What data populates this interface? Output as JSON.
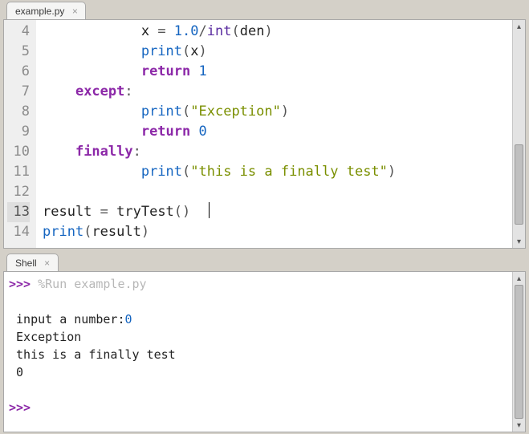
{
  "editor": {
    "tab_label": "example.py",
    "first_line_no": 4,
    "current_line_no": 13,
    "lines": [
      {
        "n": 4,
        "segs": [
          [
            "            ",
            "nm"
          ],
          [
            "x ",
            "nm"
          ],
          [
            "= ",
            "op"
          ],
          [
            "1.0",
            "num"
          ],
          [
            "/",
            "op"
          ],
          [
            "int",
            "bi"
          ],
          [
            "(",
            "op"
          ],
          [
            "den",
            "nm"
          ],
          [
            ")",
            "op"
          ]
        ]
      },
      {
        "n": 5,
        "segs": [
          [
            "            ",
            "nm"
          ],
          [
            "print",
            "fn"
          ],
          [
            "(",
            "op"
          ],
          [
            "x",
            "nm"
          ],
          [
            ")",
            "op"
          ]
        ]
      },
      {
        "n": 6,
        "segs": [
          [
            "            ",
            "nm"
          ],
          [
            "return",
            "kw"
          ],
          [
            " ",
            "nm"
          ],
          [
            "1",
            "num"
          ]
        ]
      },
      {
        "n": 7,
        "segs": [
          [
            "    ",
            "nm"
          ],
          [
            "except",
            "kw"
          ],
          [
            ":",
            "op"
          ]
        ]
      },
      {
        "n": 8,
        "segs": [
          [
            "            ",
            "nm"
          ],
          [
            "print",
            "fn"
          ],
          [
            "(",
            "op"
          ],
          [
            "\"Exception\"",
            "str"
          ],
          [
            ")",
            "op"
          ]
        ]
      },
      {
        "n": 9,
        "segs": [
          [
            "            ",
            "nm"
          ],
          [
            "return",
            "kw"
          ],
          [
            " ",
            "nm"
          ],
          [
            "0",
            "num"
          ]
        ]
      },
      {
        "n": 10,
        "segs": [
          [
            "    ",
            "nm"
          ],
          [
            "finally",
            "kw"
          ],
          [
            ":",
            "op"
          ]
        ]
      },
      {
        "n": 11,
        "segs": [
          [
            "            ",
            "nm"
          ],
          [
            "print",
            "fn"
          ],
          [
            "(",
            "op"
          ],
          [
            "\"this is a finally test\"",
            "str"
          ],
          [
            ")",
            "op"
          ]
        ]
      },
      {
        "n": 12,
        "segs": []
      },
      {
        "n": 13,
        "segs": [
          [
            "result ",
            "nm"
          ],
          [
            "= ",
            "op"
          ],
          [
            "tryTest",
            "nm"
          ],
          [
            "()  ",
            "op"
          ]
        ],
        "cursor_after": true
      },
      {
        "n": 14,
        "segs": [
          [
            "print",
            "fn"
          ],
          [
            "(",
            "op"
          ],
          [
            "result",
            "nm"
          ],
          [
            ")",
            "op"
          ]
        ]
      }
    ]
  },
  "shell": {
    "tab_label": "Shell",
    "lines": [
      {
        "segs": [
          [
            ">>> ",
            "prompt"
          ],
          [
            "%Run example.py",
            "runcmd"
          ]
        ]
      },
      {
        "segs": [
          [
            "",
            ""
          ]
        ]
      },
      {
        "segs": [
          [
            " input a number:",
            ""
          ],
          [
            "0",
            "sh-num"
          ]
        ]
      },
      {
        "segs": [
          [
            " Exception",
            ""
          ]
        ]
      },
      {
        "segs": [
          [
            " this is a finally test",
            ""
          ]
        ]
      },
      {
        "segs": [
          [
            " 0",
            ""
          ]
        ]
      },
      {
        "segs": [
          [
            "",
            ""
          ]
        ]
      },
      {
        "segs": [
          [
            ">>> ",
            "prompt"
          ]
        ]
      }
    ]
  }
}
